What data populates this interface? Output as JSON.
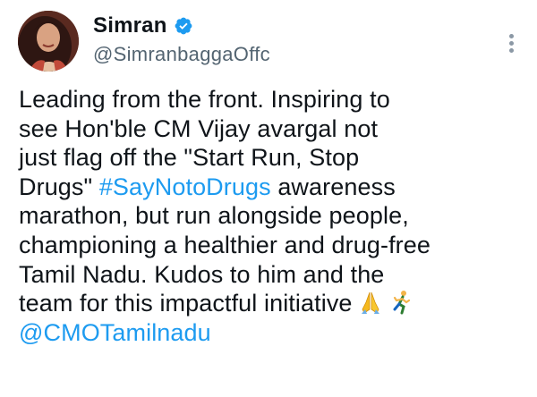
{
  "author": {
    "display_name": "Simran",
    "handle": "@SimranbaggaOffc",
    "verified": true,
    "avatar_icon": "profile-photo"
  },
  "menu": {
    "icon": "more-vertical-icon"
  },
  "tweet": {
    "line1": "Leading from the front. Inspiring to",
    "line2": "see Hon'ble CM Vijay avargal not",
    "line3": "just flag off the \"Start Run, Stop",
    "line4_pre": "Drugs\" ",
    "hashtag": "#SayNotoDrugs",
    "line4_post": " awareness",
    "line5": "marathon, but run alongside people,",
    "line6": "championing a healthier and drug-free",
    "line7": "Tamil Nadu. Kudos to him and the",
    "line8": "team for this impactful initiative ",
    "emojis": [
      "folded-hands-icon",
      "person-running-icon"
    ],
    "mention": "@CMOTamilnadu"
  },
  "colors": {
    "link": "#1d9bf0",
    "verified_badge": "#1d9bf0",
    "secondary_text": "#536471",
    "primary_text": "#0f1419"
  }
}
